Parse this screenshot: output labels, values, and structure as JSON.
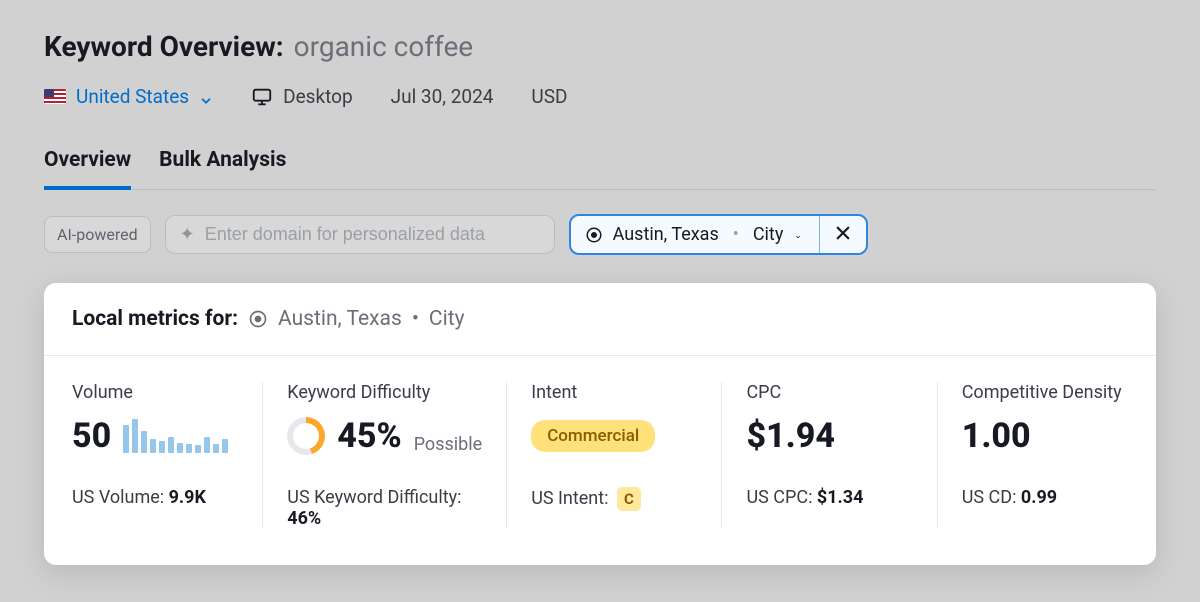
{
  "header": {
    "title_prefix": "Keyword Overview:",
    "keyword": "organic coffee"
  },
  "filters": {
    "country": "United States",
    "device": "Desktop",
    "date": "Jul 30, 2024",
    "currency": "USD"
  },
  "tabs": {
    "overview": "Overview",
    "bulk": "Bulk Analysis"
  },
  "search": {
    "ai_badge": "AI-powered",
    "placeholder": "Enter domain for personalized data"
  },
  "location": {
    "name": "Austin, Texas",
    "type": "City"
  },
  "card": {
    "header_label": "Local metrics for:",
    "location_name": "Austin, Texas",
    "location_type": "City"
  },
  "metrics": {
    "volume": {
      "title": "Volume",
      "value": "50",
      "us_label": "US Volume:",
      "us_value": "9.9K",
      "trend": [
        28,
        34,
        22,
        14,
        12,
        16,
        10,
        9,
        8,
        16,
        9,
        14
      ]
    },
    "kd": {
      "title": "Keyword Difficulty",
      "value": "45%",
      "qualifier": "Possible",
      "us_label": "US Keyword Difficulty:",
      "us_value": "46%"
    },
    "intent": {
      "title": "Intent",
      "badge": "Commercial",
      "us_label": "US Intent:",
      "us_badge": "C"
    },
    "cpc": {
      "title": "CPC",
      "value": "$1.94",
      "us_label": "US CPC:",
      "us_value": "$1.34"
    },
    "cd": {
      "title": "Competitive Density",
      "value": "1.00",
      "us_label": "US CD:",
      "us_value": "0.99"
    }
  }
}
